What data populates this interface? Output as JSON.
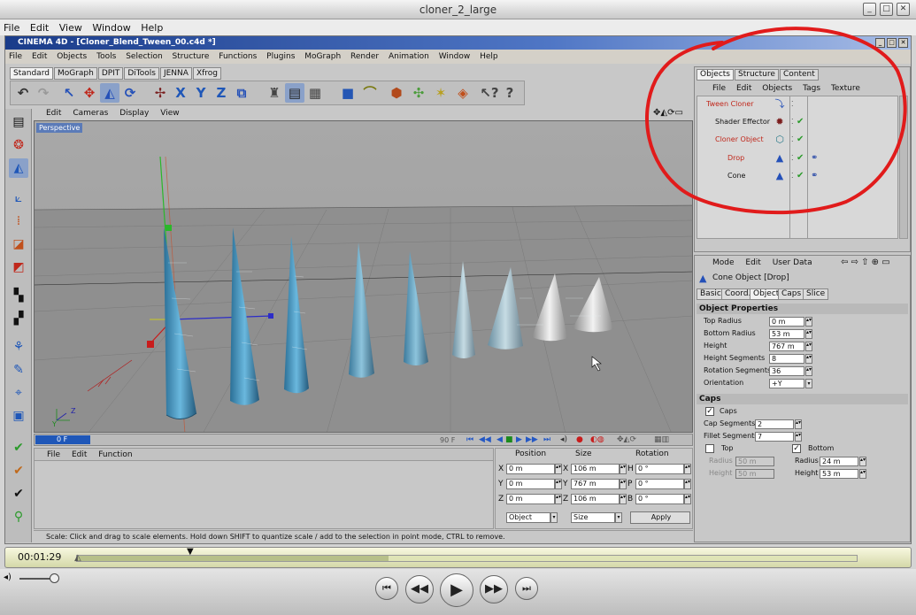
{
  "player": {
    "title": "cloner_2_large",
    "menu": [
      "File",
      "Edit",
      "View",
      "Window",
      "Help"
    ],
    "timecode": "00:01:29",
    "progress": 0.4
  },
  "c4d": {
    "title": "CINEMA 4D - [Cloner_Blend_Tween_00.c4d *]",
    "menu": [
      "File",
      "Edit",
      "Objects",
      "Tools",
      "Selection",
      "Structure",
      "Functions",
      "Plugins",
      "MoGraph",
      "Render",
      "Animation",
      "Window",
      "Help"
    ],
    "palette_tabs": [
      "Standard",
      "MoGraph",
      "DPIT",
      "DiTools",
      "JENNA",
      "Xfrog"
    ],
    "toolbar_letters": [
      "X",
      "Y",
      "Z"
    ],
    "viewport_menu": [
      "Edit",
      "Cameras",
      "Display",
      "View"
    ],
    "viewport_label": "Perspective",
    "timeline": {
      "current": "0 F",
      "end": "90 F"
    },
    "fcurve_menu": [
      "File",
      "Edit",
      "Function"
    ],
    "coords": {
      "headers": [
        "Position",
        "Size",
        "Rotation"
      ],
      "rows": [
        {
          "axis": "X",
          "pos": "0 m",
          "size_axis": "X",
          "size": "106 m",
          "rot_axis": "H",
          "rot": "0 °"
        },
        {
          "axis": "Y",
          "pos": "0 m",
          "size_axis": "Y",
          "size": "767 m",
          "rot_axis": "P",
          "rot": "0 °"
        },
        {
          "axis": "Z",
          "pos": "0 m",
          "size_axis": "Z",
          "size": "106 m",
          "rot_axis": "B",
          "rot": "0 °"
        }
      ],
      "mode": "Object",
      "size_mode": "Size",
      "apply": "Apply"
    },
    "status": "Scale: Click and drag to scale elements. Hold down SHIFT to quantize scale / add to the selection in point mode, CTRL to remove."
  },
  "objects": {
    "tabs": [
      "Objects",
      "Structure",
      "Content"
    ],
    "menu": [
      "File",
      "Edit",
      "Objects",
      "Tags",
      "Texture"
    ],
    "items": [
      {
        "name": "Tween Cloner",
        "indent": 0
      },
      {
        "name": "Shader Effector",
        "indent": 1
      },
      {
        "name": "Cloner Object",
        "indent": 1
      },
      {
        "name": "Drop",
        "indent": 2
      },
      {
        "name": "Cone",
        "indent": 2
      }
    ]
  },
  "attributes": {
    "menu": [
      "Mode",
      "Edit",
      "User Data"
    ],
    "object": "Cone Object [Drop]",
    "tabs": [
      "Basic",
      "Coord.",
      "Object",
      "Caps",
      "Slice"
    ],
    "section_object": "Object Properties",
    "props": [
      {
        "label": "Top Radius",
        "value": "0 m"
      },
      {
        "label": "Bottom Radius",
        "value": "53 m"
      },
      {
        "label": "Height",
        "value": "767 m"
      },
      {
        "label": "Height Segments",
        "value": "8"
      },
      {
        "label": "Rotation Segments",
        "value": "36"
      },
      {
        "label": "Orientation",
        "value": "+Y"
      }
    ],
    "section_caps": "Caps",
    "caps_label": "Caps",
    "cap_segments_label": "Cap Segments",
    "cap_segments": "2",
    "fillet_segments_label": "Fillet Segments",
    "fillet_segments": "7",
    "top_label": "Top",
    "bottom_label": "Bottom",
    "radius_label": "Radius",
    "height_label": "Height",
    "top_radius": "50 m",
    "top_height": "50 m",
    "bottom_radius": "24 m",
    "bottom_height": "53 m"
  }
}
